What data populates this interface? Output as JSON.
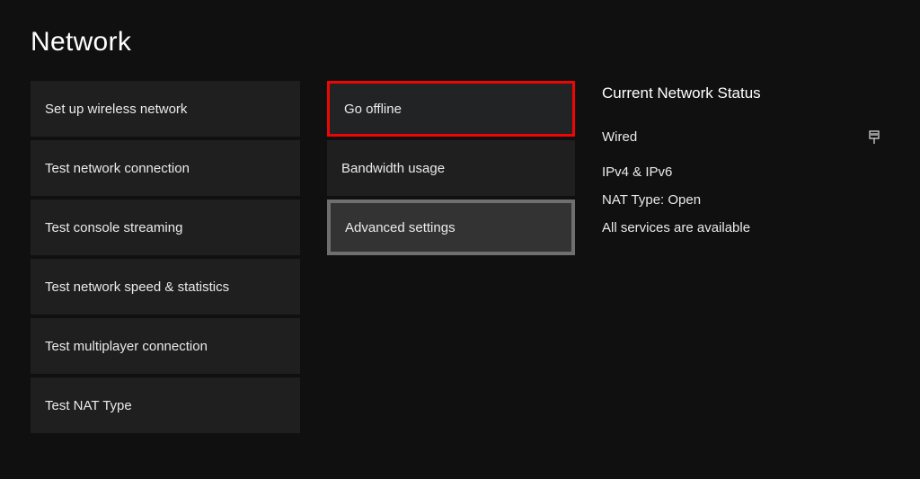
{
  "title": "Network",
  "left": {
    "setup_wireless": "Set up wireless network",
    "test_connection": "Test network connection",
    "test_streaming": "Test console streaming",
    "test_speed": "Test network speed & statistics",
    "test_multiplayer": "Test multiplayer connection",
    "test_nat": "Test NAT Type"
  },
  "mid": {
    "go_offline": "Go offline",
    "bandwidth": "Bandwidth usage",
    "advanced": "Advanced settings"
  },
  "status": {
    "heading": "Current Network Status",
    "connection_label": "Wired",
    "connection_icon": "ethernet-icon",
    "ip": "IPv4 & IPv6",
    "nat": "NAT Type: Open",
    "services": "All services are available"
  }
}
